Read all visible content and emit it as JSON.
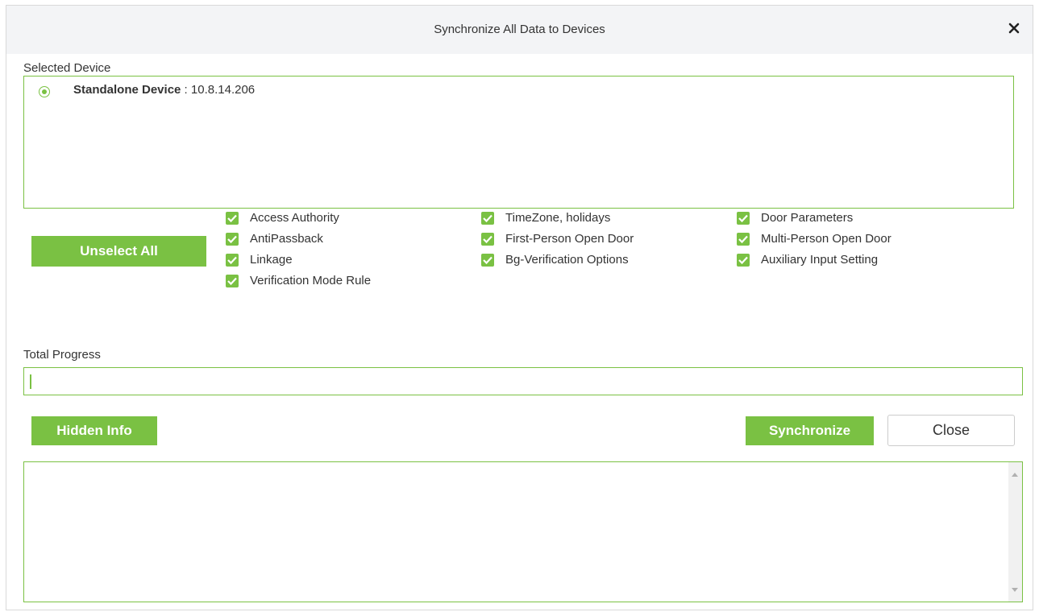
{
  "dialog": {
    "title": "Synchronize All Data to Devices",
    "close_icon": "close-icon"
  },
  "selected_device": {
    "label": "Selected Device",
    "devices": [
      {
        "name": "Standalone Device",
        "separator": " : ",
        "ip": "10.8.14.206",
        "selected": true
      }
    ]
  },
  "buttons": {
    "unselect_all": "Unselect All",
    "hidden_info": "Hidden Info",
    "synchronize": "Synchronize",
    "close": "Close"
  },
  "options": [
    {
      "label": "Access Authority",
      "checked": true
    },
    {
      "label": "AntiPassback",
      "checked": true
    },
    {
      "label": "Linkage",
      "checked": true
    },
    {
      "label": "Verification Mode Rule",
      "checked": true
    },
    {
      "label": "TimeZone, holidays",
      "checked": true
    },
    {
      "label": "First-Person Open Door",
      "checked": true
    },
    {
      "label": "Bg-Verification Options",
      "checked": true
    },
    {
      "label": "Door Parameters",
      "checked": true
    },
    {
      "label": "Multi-Person Open Door",
      "checked": true
    },
    {
      "label": "Auxiliary Input Setting",
      "checked": true
    }
  ],
  "progress": {
    "label": "Total Progress",
    "value": 0
  },
  "log": {
    "content": ""
  },
  "colors": {
    "accent": "#7ac143",
    "titlebar_bg": "#f3f4f6",
    "text": "#333333"
  }
}
